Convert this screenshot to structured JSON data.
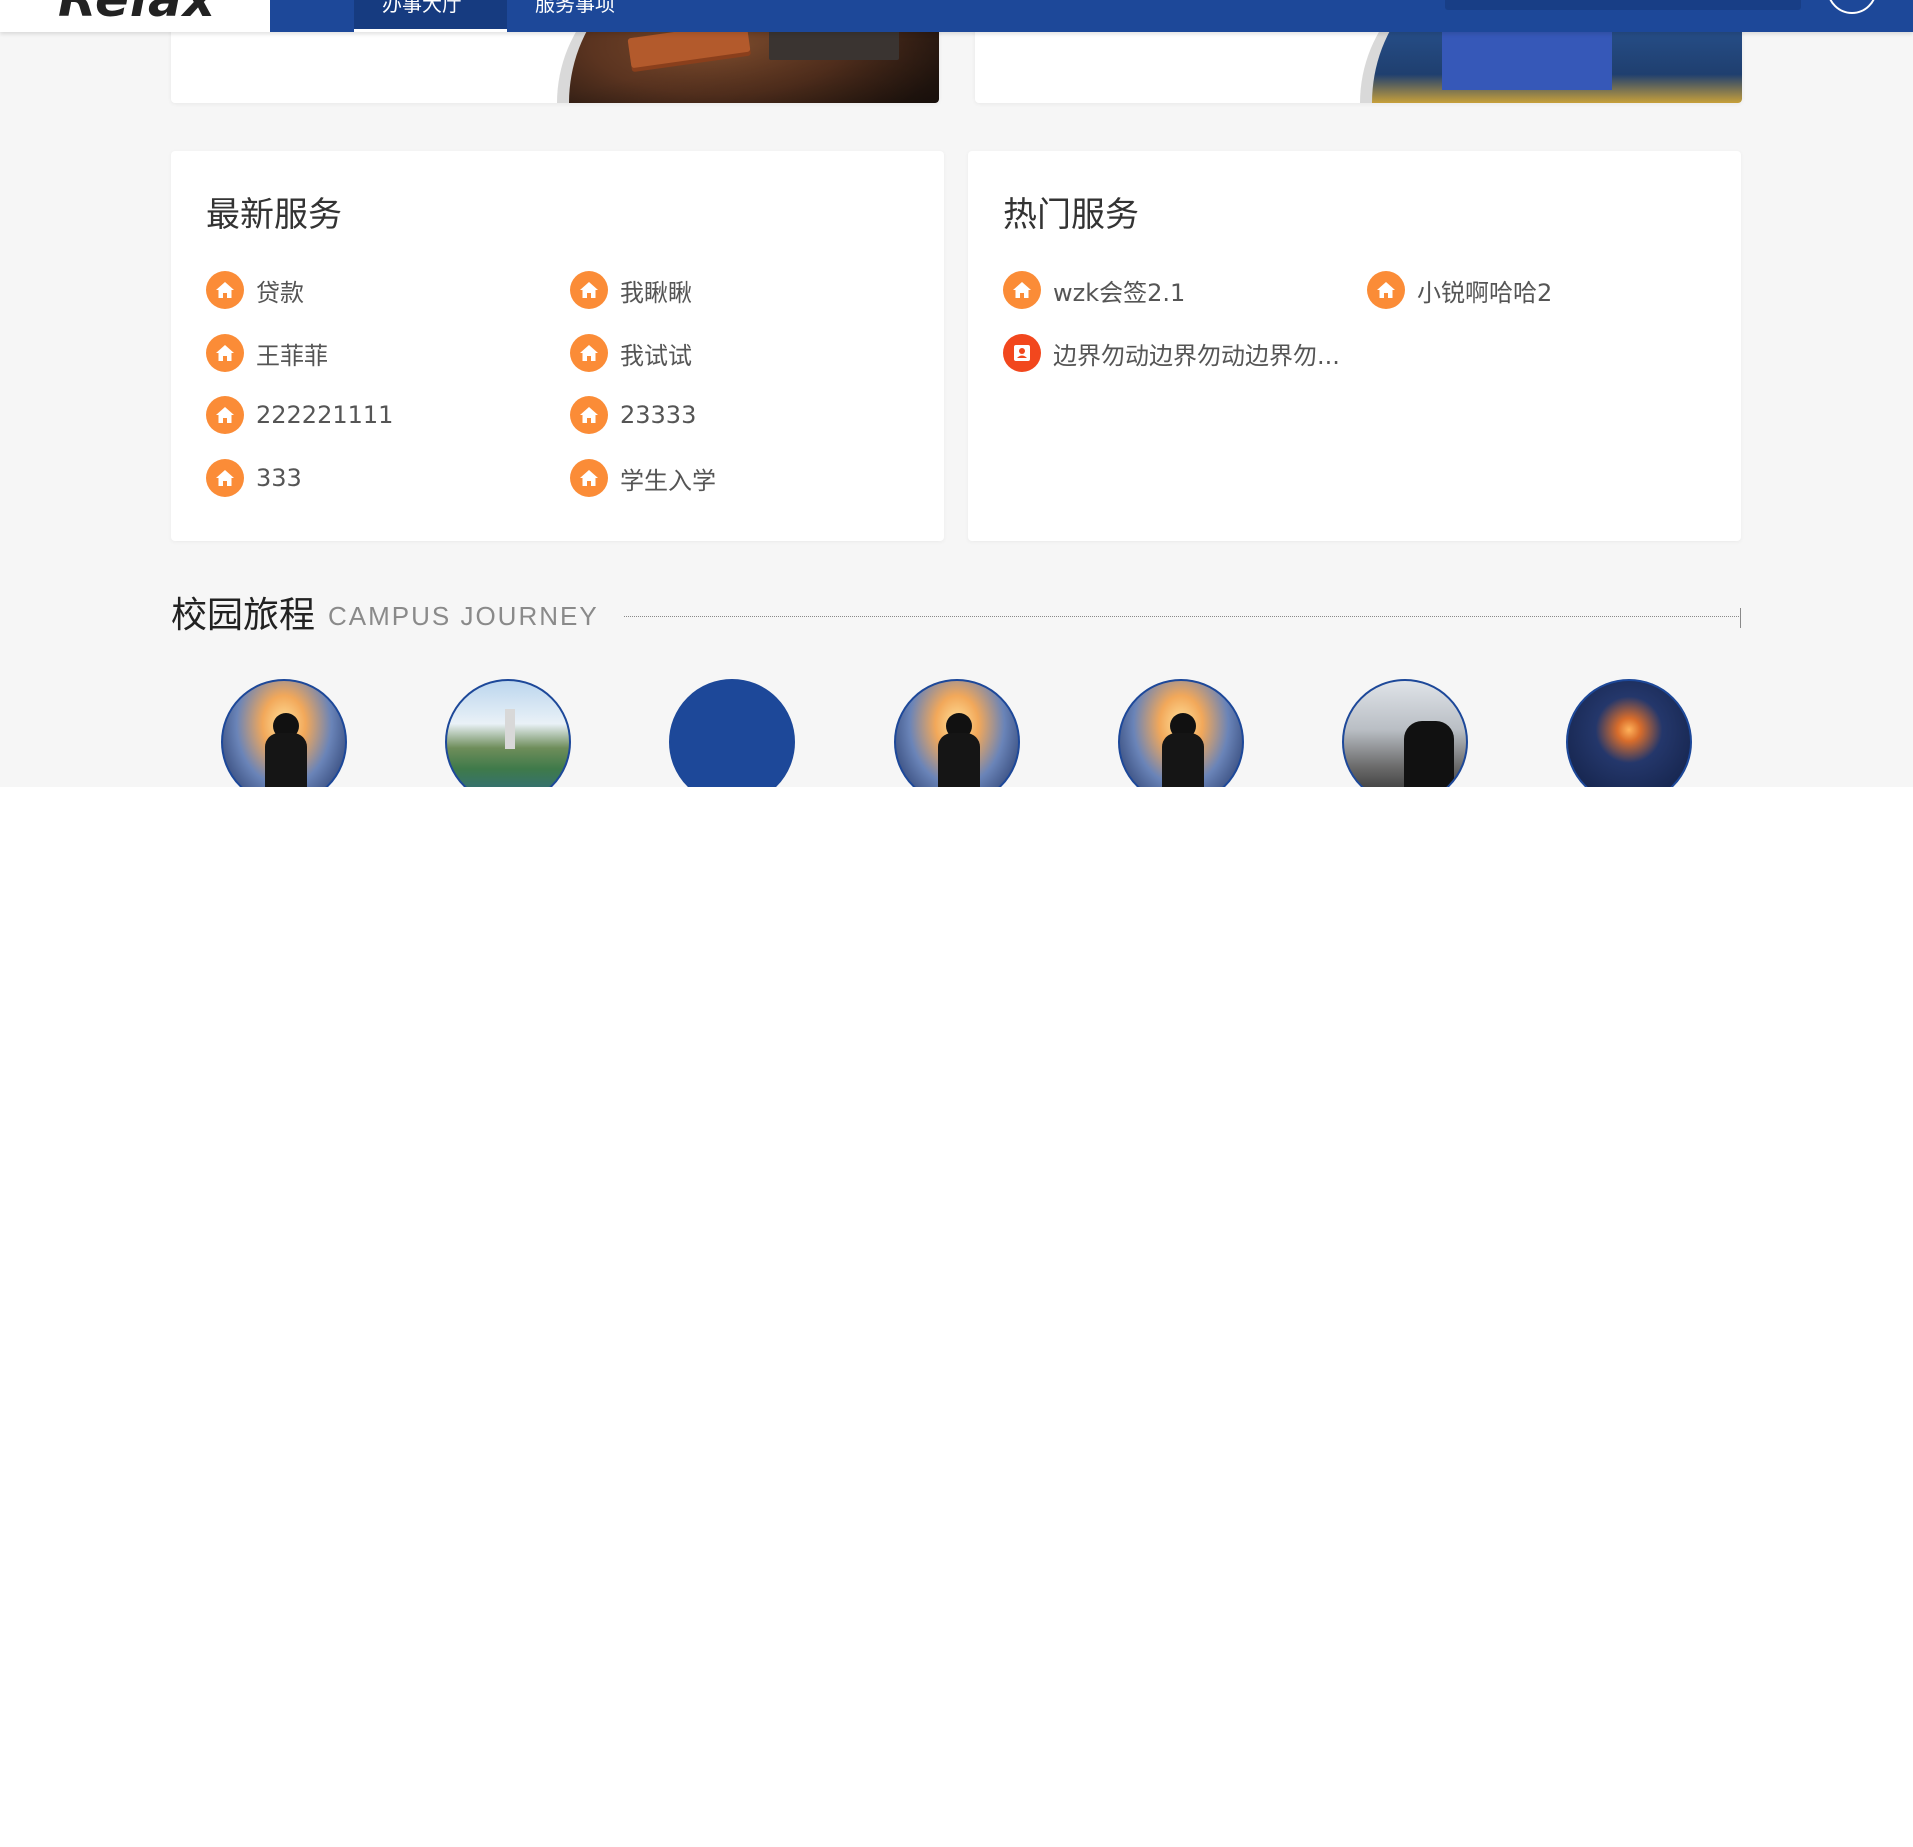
{
  "header": {
    "logo_text": "Relax",
    "nav": [
      {
        "label": "办事大厅",
        "active": true
      },
      {
        "label": "服务事项",
        "active": false
      }
    ]
  },
  "latest_services": {
    "title": "最新服务",
    "items": [
      {
        "label": "贷款",
        "icon": "home-icon"
      },
      {
        "label": "我瞅瞅",
        "icon": "home-icon"
      },
      {
        "label": "王菲菲",
        "icon": "home-icon"
      },
      {
        "label": "我试试",
        "icon": "home-icon"
      },
      {
        "label": "222221111",
        "icon": "home-icon"
      },
      {
        "label": "23333",
        "icon": "home-icon"
      },
      {
        "label": "333",
        "icon": "home-icon"
      },
      {
        "label": "学生入学",
        "icon": "home-icon"
      }
    ]
  },
  "hot_services": {
    "title": "热门服务",
    "items": [
      {
        "label": "wzk会签2.1",
        "icon": "home-icon"
      },
      {
        "label": "小锐啊哈哈2",
        "icon": "home-icon"
      },
      {
        "label": "边界勿动边界勿动边界勿...",
        "icon": "id-card-icon"
      }
    ]
  },
  "campus_journey": {
    "title": "校园旅程",
    "subtitle": "CAMPUS JOURNEY",
    "thumbnails": [
      "sunset-traveler",
      "campus-lake",
      "blank",
      "sunset-traveler",
      "sunset-traveler",
      "graduation",
      "sparklers"
    ]
  },
  "colors": {
    "primary": "#1d4899",
    "accent_orange": "#fb8c37",
    "accent_red": "#f2471d",
    "page_bg": "#f6f6f6"
  }
}
